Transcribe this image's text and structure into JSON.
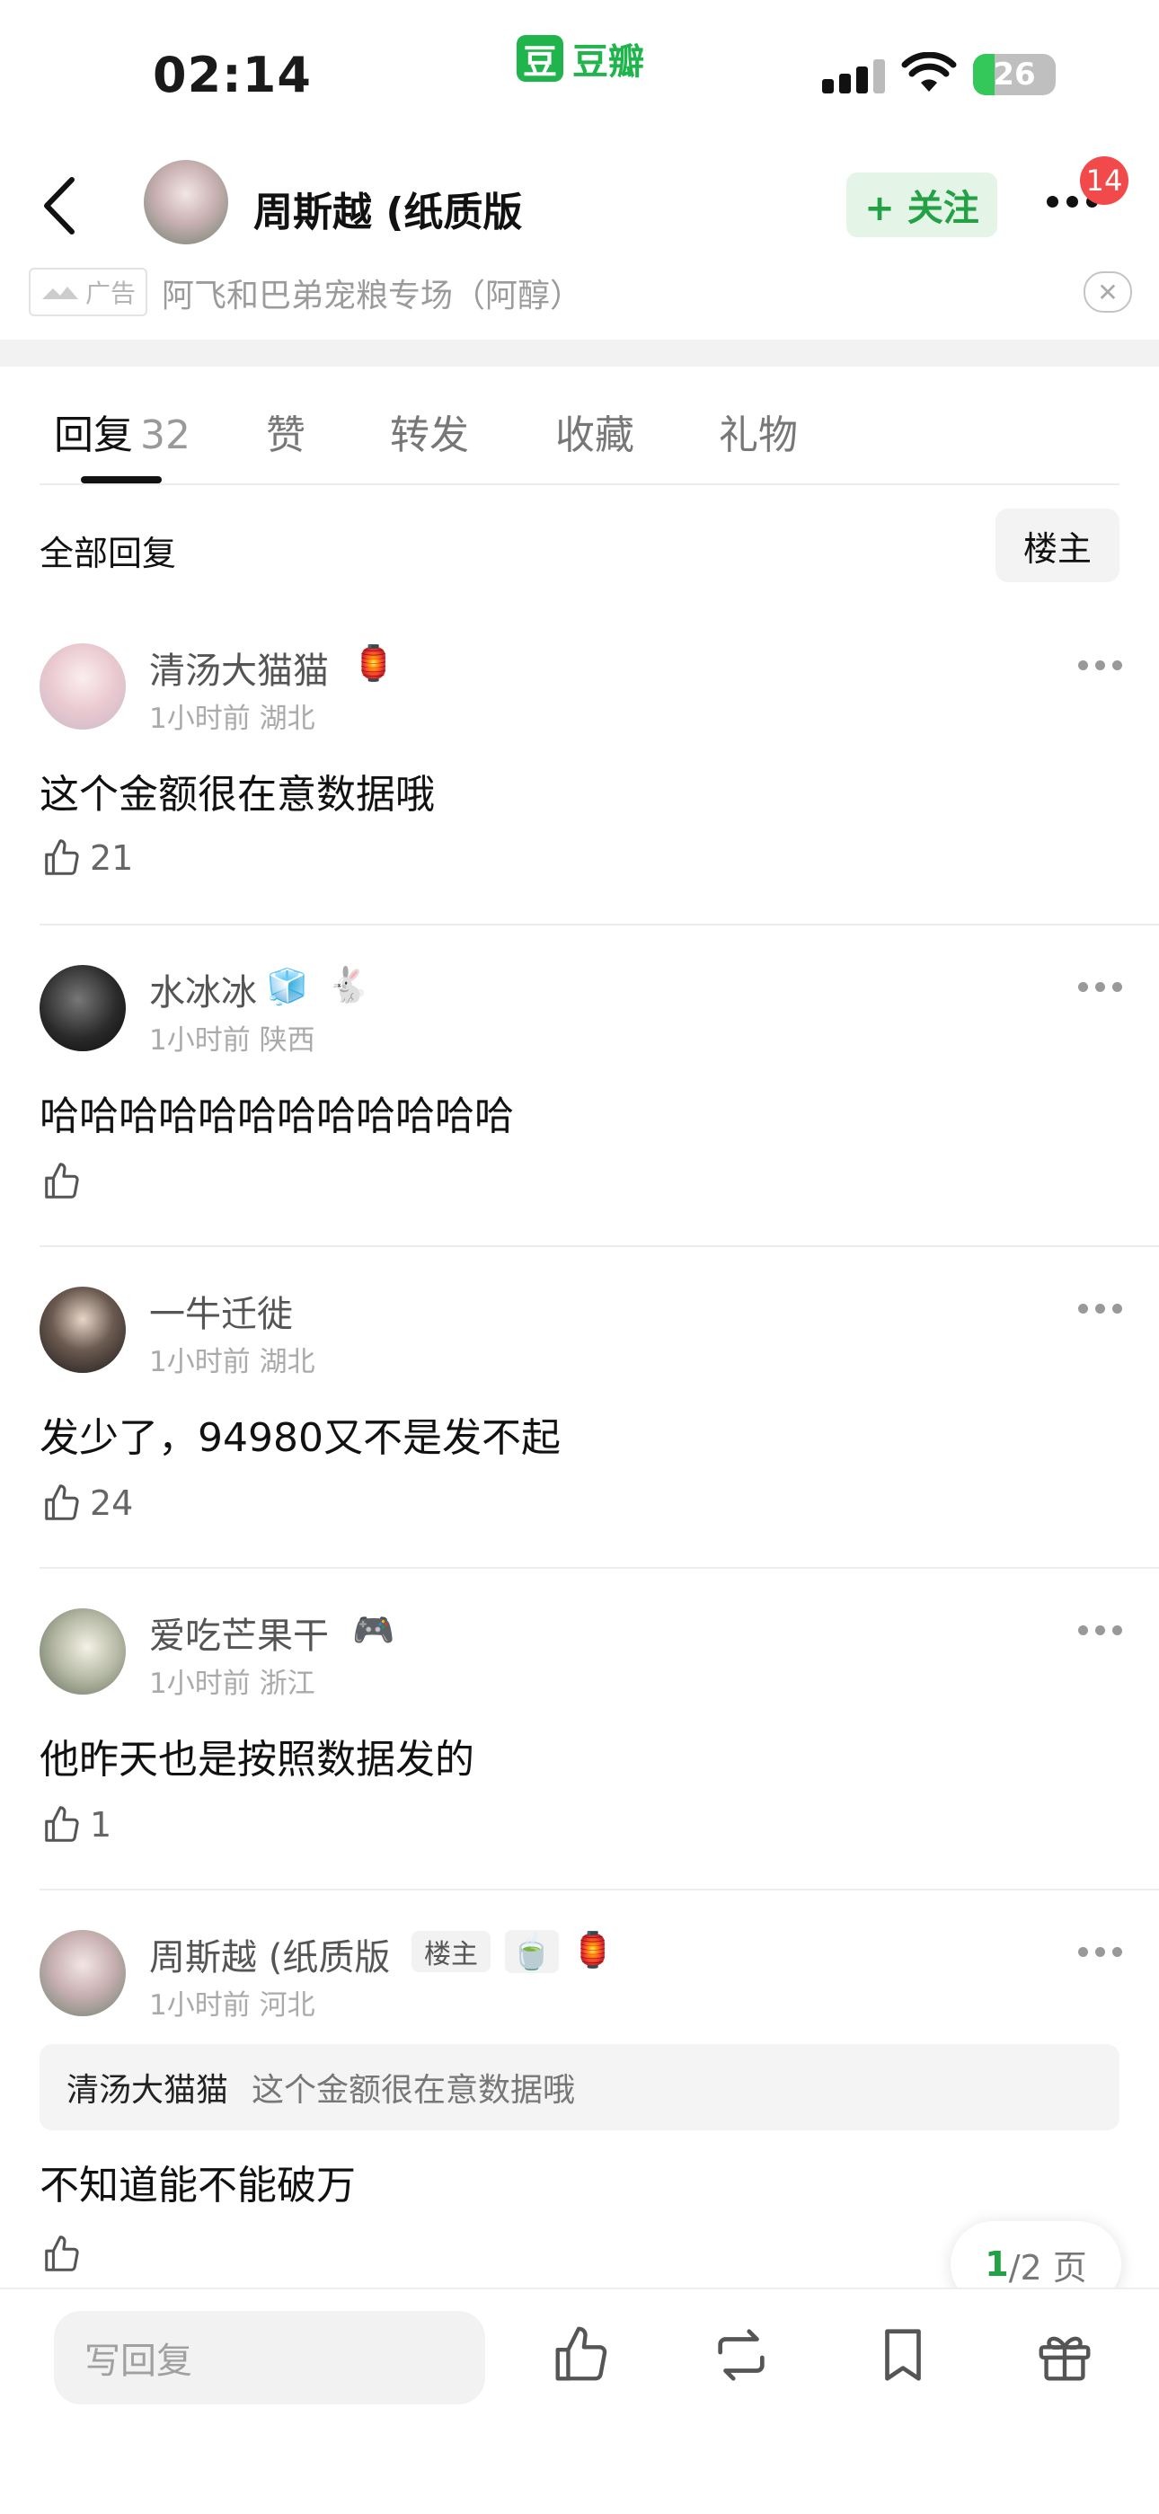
{
  "status_bar": {
    "time": "02:14",
    "app_logo_char": "豆",
    "app_name": "豆瓣",
    "battery": "26"
  },
  "header": {
    "title": "周斯越 (纸质版",
    "follow_label": "+ 关注",
    "notification_count": "14"
  },
  "ad": {
    "tag": "广告",
    "text": "阿飞和巴弟宠粮专场（阿醇）"
  },
  "tabs": [
    {
      "label": "回复",
      "count": "32"
    },
    {
      "label": "赞"
    },
    {
      "label": "转发"
    },
    {
      "label": "收藏"
    },
    {
      "label": "礼物"
    }
  ],
  "filter": {
    "all_label": "全部回复",
    "op_label": "楼主"
  },
  "comments": [
    {
      "name": "清汤大猫猫",
      "meta": "1小时前 湖北",
      "text": "这个金额很在意数据哦",
      "likes": "21"
    },
    {
      "name": "水冰冰",
      "meta": "1小时前 陕西",
      "text": "哈哈哈哈哈哈哈哈哈哈哈哈",
      "likes": ""
    },
    {
      "name": "一牛迁徙",
      "meta": "1小时前 湖北",
      "text": "发少了，94980又不是发不起",
      "likes": "24"
    },
    {
      "name": "爱吃芒果干",
      "meta": "1小时前 浙江",
      "text": "他昨天也是按照数据发的",
      "likes": "1"
    },
    {
      "name": "周斯越 (纸质版",
      "tag": "楼主",
      "meta": "1小时前 河北",
      "quote_name": "清汤大猫猫",
      "quote_text": "这个金额很在意数据哦",
      "text": "不知道能不能破万",
      "likes": ""
    }
  ],
  "pager": {
    "current": "1",
    "total_text": "/2 页"
  },
  "bottom": {
    "reply_placeholder": "写回复"
  },
  "colors": {
    "accent": "#23a145",
    "badge": "#f24a4a"
  }
}
